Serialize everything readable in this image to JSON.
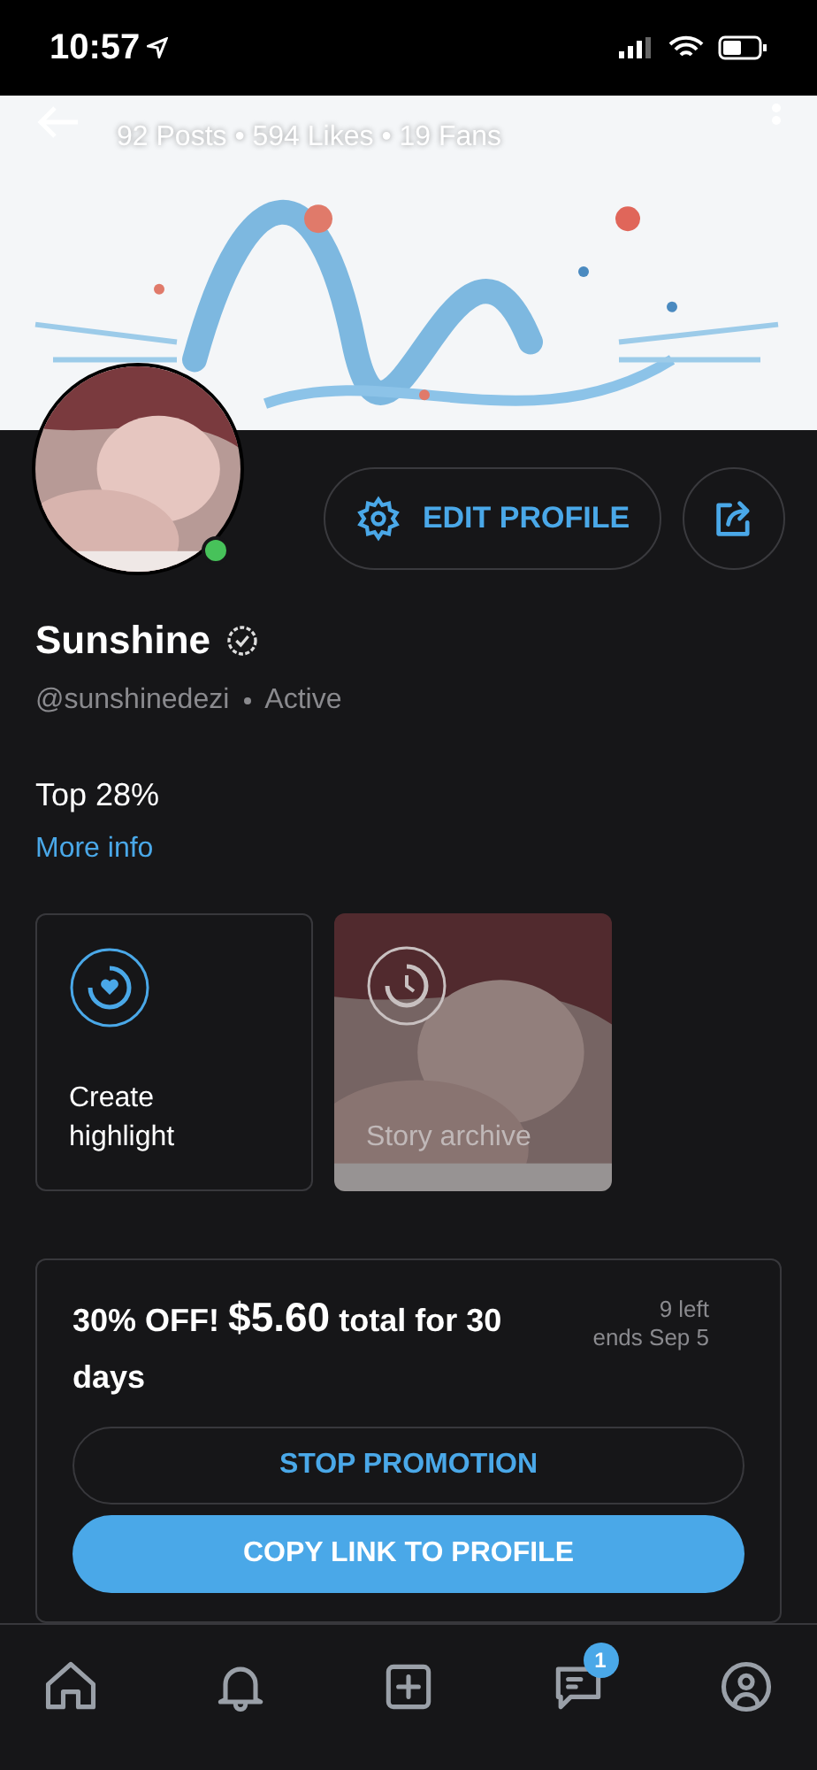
{
  "status_bar": {
    "time": "10:57"
  },
  "cover": {
    "stats": "92 Posts • 594 Likes • 19 Fans"
  },
  "profile": {
    "name": "Sunshine",
    "verified": true,
    "online": true,
    "handle": "@sunshinedezi",
    "activity": "Active",
    "edit_button": "EDIT PROFILE"
  },
  "rank": {
    "text": "Top 28%",
    "link": "More info"
  },
  "highlights": [
    {
      "kind": "create",
      "label": "Create highlight"
    },
    {
      "kind": "archive",
      "label": "Story archive"
    }
  ],
  "promotion": {
    "discount": "30% OFF!",
    "price": "$5.60",
    "terms": "total for 30 days",
    "remaining": "9 left",
    "ends": "ends Sep 5",
    "stop_button": "STOP PROMOTION",
    "copy_button": "COPY LINK TO PROFILE"
  },
  "bottom_nav": [
    {
      "kind": "home"
    },
    {
      "kind": "notifications"
    },
    {
      "kind": "add"
    },
    {
      "kind": "messages",
      "badge": "1"
    },
    {
      "kind": "profile"
    }
  ]
}
